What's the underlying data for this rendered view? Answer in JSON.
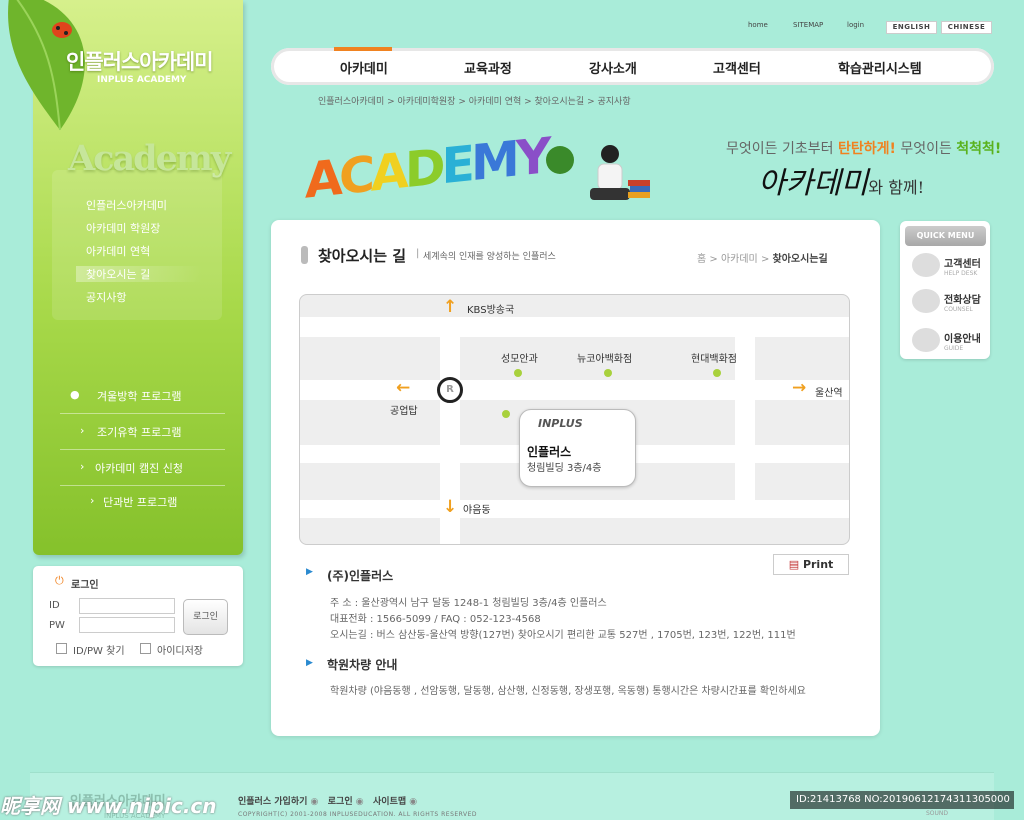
{
  "brand": {
    "name": "인플러스아카데미",
    "sub": "INPLUS ACADEMY",
    "section_word": "Academy"
  },
  "submenu": [
    "인플러스아카데미",
    "아카데미 학원장",
    "아카데미 연혁",
    "찾아오시는 길",
    "공지사항"
  ],
  "programs": [
    "겨울방학 프로그램",
    "조기유학 프로그램",
    "아카데미 캠진 신청",
    "단과반 프로그램"
  ],
  "login": {
    "title": "로그인",
    "id_label": "ID",
    "pw_label": "PW",
    "button": "로그인",
    "find": "ID/PW 찾기",
    "save_id": "아이디저장"
  },
  "top_links": [
    "home",
    "SITEMAP",
    "login"
  ],
  "languages": [
    "ENGLISH",
    "CHINESE"
  ],
  "gnb": [
    "아카데미",
    "교육과정",
    "강사소개",
    "고객센터",
    "학습관리시스템"
  ],
  "top_breadcrumb": "인플러스아카데미 > 아카데미학원장 > 아카데미 연혁 > 찾아오시는길 > 공지사항",
  "banner": {
    "word": "ACADEMY",
    "line1_a": "무엇이든 기초부터",
    "line1_b": "탄탄하게!",
    "line1_c": "무엇이든",
    "line1_d": "척척척!",
    "line2": "아카데미",
    "line2_suffix": "와 함께!"
  },
  "page": {
    "title": "찾아오시는 길",
    "subtitle": "세계속의 인재를 양성하는 인플러스",
    "crumb_home": "홈",
    "crumb_mid": "아카데미",
    "crumb_current": "찾아오시는길"
  },
  "map": {
    "north": "KBS방송국",
    "west": "공업탑",
    "east": "울산역",
    "south": "야음동",
    "landmarks": [
      "성모안과",
      "뉴코아백화점",
      "현대백화점"
    ],
    "rotary": "R",
    "popup_logo": "INPLUS",
    "popup_name": "인플러스",
    "popup_addr": "청림빌딩 3층/4층"
  },
  "print_label": "Print",
  "company": {
    "title": "(주)인플러스",
    "address": "주     소 : 울산광역시 남구 달동 1248-1 청림빌딩 3층/4층 인플러스",
    "phone": "대표전화 : 1566-5099 / FAQ : 052-123-4568",
    "directions": "오시는길 : 버스 삼산동-울산역 방향(127번) 찾아오시기 편리한 교통 527번 , 1705번, 123번, 122번, 111번"
  },
  "shuttle": {
    "title": "학원차량 안내",
    "text": "학원차량 (야음동행 , 선암동행, 달동행, 삼산행, 신정동행, 장생포행, 옥동행) 통행시간은  차량시간표를 확인하세요"
  },
  "quick_menu": {
    "title": "QUICK MENU",
    "items": [
      {
        "label": "고객센터",
        "sub": "HELP DESK"
      },
      {
        "label": "전화상담",
        "sub": "COUNSEL"
      },
      {
        "label": "이용안내",
        "sub": "GUIDE"
      }
    ]
  },
  "footer": {
    "logo": "인플러스아카데미",
    "logo_sub": "INPLUS ACADEMY",
    "links": [
      "인플러스 가입하기",
      "로그인",
      "사이트맵"
    ],
    "copyright": "COPYRIGHT(C) 2001-2008 INPLUSEDUCATION. ALL RIGHTS RESERVED",
    "sound": "SOUND"
  },
  "watermark": {
    "site": "昵享网 www.nipic.cn",
    "id": "ID:21413768 NO:20190612174311305000"
  },
  "colors": {
    "accent_orange": "#f08220",
    "leaf_green": "#a8d94a",
    "background": "#a9ecd9"
  }
}
